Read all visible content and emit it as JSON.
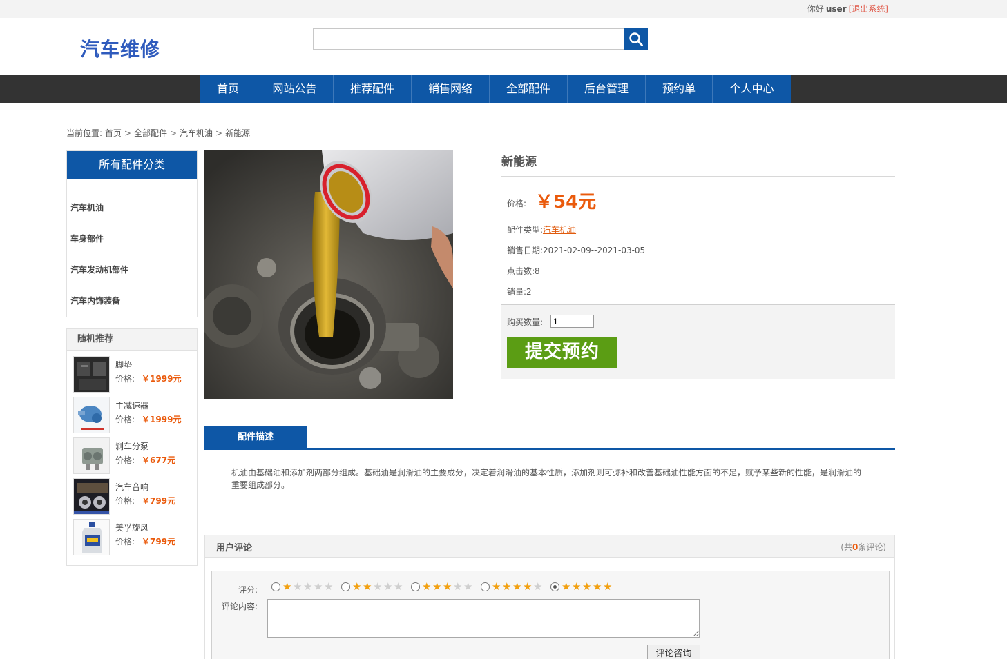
{
  "topbar": {
    "greeting": "你好",
    "username": "user",
    "logout": "[退出系统]"
  },
  "header": {
    "logo": "汽车维修",
    "search_placeholder": ""
  },
  "nav": [
    "首页",
    "网站公告",
    "推荐配件",
    "销售网络",
    "全部配件",
    "后台管理",
    "预约单",
    "个人中心"
  ],
  "breadcrumb": {
    "prefix": "当前位置:",
    "items": [
      "首页",
      "全部配件",
      "汽车机油",
      "新能源"
    ],
    "sep": ">"
  },
  "sidebar": {
    "category_title": "所有配件分类",
    "categories": [
      "汽车机油",
      "车身部件",
      "汽车发动机部件",
      "汽车内饰装备"
    ],
    "recommend_title": "随机推荐",
    "recommend": [
      {
        "name": "脚垫",
        "price_label": "价格:",
        "price": "￥1999元"
      },
      {
        "name": "主减速器",
        "price_label": "价格:",
        "price": "￥1999元"
      },
      {
        "name": "刹车分泵",
        "price_label": "价格:",
        "price": "￥677元"
      },
      {
        "name": "汽车音响",
        "price_label": "价格:",
        "price": "￥799元"
      },
      {
        "name": "美孚旋风",
        "price_label": "价格:",
        "price": "￥799元"
      }
    ]
  },
  "product": {
    "name": "新能源",
    "price_label": "价格:",
    "price": "￥54元",
    "type_label": "配件类型:",
    "type_value": "汽车机油",
    "date_label": "销售日期:",
    "date_value": "2021-02-09--2021-03-05",
    "clicks_label": "点击数:",
    "clicks_value": "8",
    "sales_label": "销量:",
    "sales_value": "2",
    "qty_label": "购买数量:",
    "qty_value": "1",
    "submit_label": "提交预约"
  },
  "description": {
    "tab_label": "配件描述",
    "text": "机油由基础油和添加剂两部分组成。基础油是润滑油的主要成分，决定着润滑油的基本性质，添加剂则可弥补和改善基础油性能方面的不足，赋予某些新的性能，是润滑油的重要组成部分。"
  },
  "comments": {
    "title": "用户评论",
    "count_prefix": "(共",
    "count": "0",
    "count_suffix": "条评论)",
    "rate_label": "评分:",
    "rating_options": [
      1,
      2,
      3,
      4,
      5
    ],
    "selected_rating": 5,
    "content_label": "评论内容:",
    "submit_label": "评论咨询"
  },
  "colors": {
    "brand": "#0e57a6",
    "accent": "#ea5a0c",
    "submit": "#5b9d14",
    "navbar": "#333333"
  }
}
